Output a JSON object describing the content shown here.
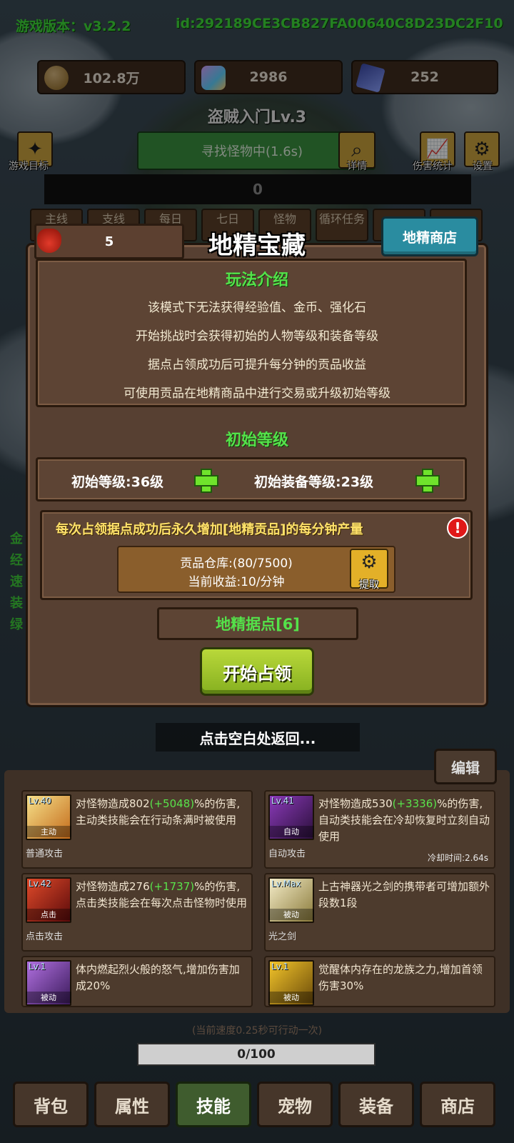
{
  "header": {
    "version": "游戏版本：v3.2.2",
    "device_id": "id:292189CE3CB827FA00640C8D23DC2F10"
  },
  "resources": [
    {
      "icon": "coin-icon",
      "value": "102.8万"
    },
    {
      "icon": "crystal-icon",
      "value": "2986"
    },
    {
      "icon": "card-icon",
      "value": "252"
    }
  ],
  "stage": {
    "title": "盗贼入门Lv.3",
    "search_status": "寻找怪物中(1.6s)",
    "damage_value": "0"
  },
  "left_buttons": {
    "goal_label": "游戏目标"
  },
  "right_buttons": {
    "detail_label": "详情",
    "stats_label": "伤害统计",
    "settings_label": "设置"
  },
  "mini_tabs": [
    "主线",
    "支线",
    "每日",
    "七日",
    "怪物",
    "循环任务",
    "",
    ""
  ],
  "side_text": [
    "金",
    "经",
    "速",
    "装",
    "绿"
  ],
  "modal": {
    "title": "地精宝藏",
    "tribute_count": "5",
    "shop_button": "地精商店",
    "intro_title": "玩法介绍",
    "intro_lines": [
      "该模式下无法获得经验值、金币、强化石",
      "开始挑战时会获得初始的人物等级和装备等级",
      "据点占领成功后可提升每分钟的贡品收益",
      "可使用贡品在地精商品中进行交易或升级初始等级"
    ],
    "level_title": "初始等级",
    "initial_level": "初始等级:36级",
    "initial_equip_level": "初始装备等级:23级",
    "notice": "每次占领据点成功后永久增加[地精贡品]的每分钟产量",
    "warehouse": "贡品仓库:(80/7500)",
    "income": "当前收益:10/分钟",
    "extract_label": "提取",
    "stronghold": "地精据点[6]",
    "start_button": "开始占领",
    "back_hint": "点击空白处返回..."
  },
  "skills": {
    "edit_label": "编辑",
    "cards": [
      {
        "lv": "Lv.40",
        "kind": "主动",
        "name": "普通攻击",
        "desc_a": "对怪物造成802",
        "desc_g": "(+5048)",
        "desc_b": "%的伤害,主动类技能会在行动条满时被使用",
        "cooldown": ""
      },
      {
        "lv": "Lv.41",
        "kind": "自动",
        "name": "自动攻击",
        "desc_a": "对怪物造成530",
        "desc_g": "(+3336)",
        "desc_b": "%的伤害,自动类技能会在冷却恢复时立刻自动使用",
        "cooldown": "冷却时间:2.64s"
      },
      {
        "lv": "Lv.42",
        "kind": "点击",
        "name": "点击攻击",
        "desc_a": "对怪物造成276",
        "desc_g": "(+1737)",
        "desc_b": "%的伤害,点击类技能会在每次点击怪物时使用",
        "cooldown": ""
      },
      {
        "lv": "Lv.Max",
        "kind": "被动",
        "name": "光之剑",
        "desc_a": "上古神器光之剑的携带者可增加额外段数1段",
        "desc_g": "",
        "desc_b": "",
        "cooldown": ""
      },
      {
        "lv": "Lv.1",
        "kind": "被动",
        "name": "",
        "desc_a": "体内燃起烈火般的怒气,增加伤害加成20%",
        "desc_g": "",
        "desc_b": "",
        "cooldown": ""
      },
      {
        "lv": "Lv.1",
        "kind": "被动",
        "name": "",
        "desc_a": "觉醒体内存在的龙族之力,增加首领伤害30%",
        "desc_g": "",
        "desc_b": "",
        "cooldown": ""
      }
    ],
    "speed_text": "(当前速度0.25秒可行动一次)",
    "progress": "0/100"
  },
  "bottom_nav": [
    {
      "label": "背包",
      "active": false
    },
    {
      "label": "属性",
      "active": false
    },
    {
      "label": "技能",
      "active": true
    },
    {
      "label": "宠物",
      "active": false
    },
    {
      "label": "装备",
      "active": false
    },
    {
      "label": "商店",
      "active": false
    }
  ],
  "colors": {
    "accent_green": "#54e24a",
    "modal_bg": "#574032",
    "shop_button": "#2a8ca0",
    "start_button": "#a6c82e",
    "notice_yellow": "#ffe26a"
  }
}
